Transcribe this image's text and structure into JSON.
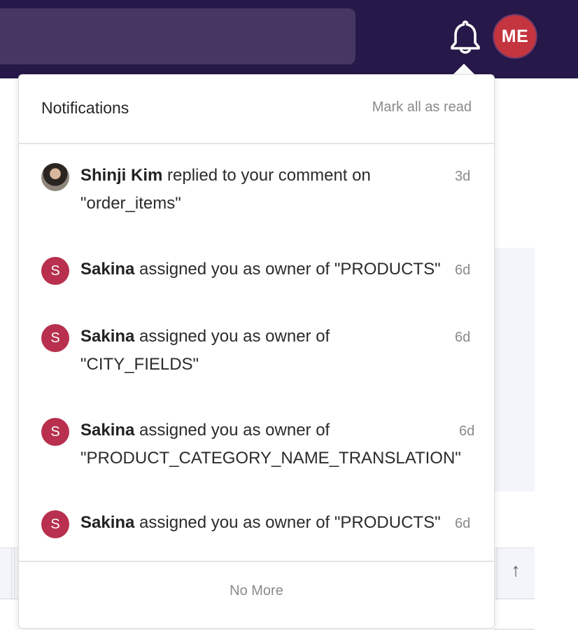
{
  "topbar": {
    "user_initials": "ME",
    "bell_icon": "bell-icon"
  },
  "notifications": {
    "title": "Notifications",
    "mark_all_label": "Mark all as read",
    "items": [
      {
        "avatar": "photo",
        "actor": "Shinji Kim",
        "action": " replied to your comment on \"order_items\"",
        "time": "3d"
      },
      {
        "avatar": "S",
        "actor": "Sakina",
        "action": " assigned you as owner of \"PRODUCTS\"",
        "time": "6d"
      },
      {
        "avatar": "S",
        "actor": "Sakina",
        "action": " assigned you as owner of \"CITY_FIELDS\"",
        "time": "6d"
      },
      {
        "avatar": "S",
        "actor": "Sakina",
        "action": " assigned you as owner of \"PRODUCT_CATEGORY_NAME_TRANSLATION\"",
        "time": "6d"
      },
      {
        "avatar": "S",
        "actor": "Sakina",
        "action": " assigned you as owner of \"PRODUCTS\"",
        "time": "6d"
      }
    ],
    "footer_label": "No More"
  },
  "background": {
    "arrow_icon": "arrow-up-icon",
    "arrow_glyph": "↑"
  },
  "colors": {
    "topbar": "#261848",
    "search": "#463762",
    "me_avatar": "#c5353f",
    "avatar_s": "#b8304e"
  }
}
